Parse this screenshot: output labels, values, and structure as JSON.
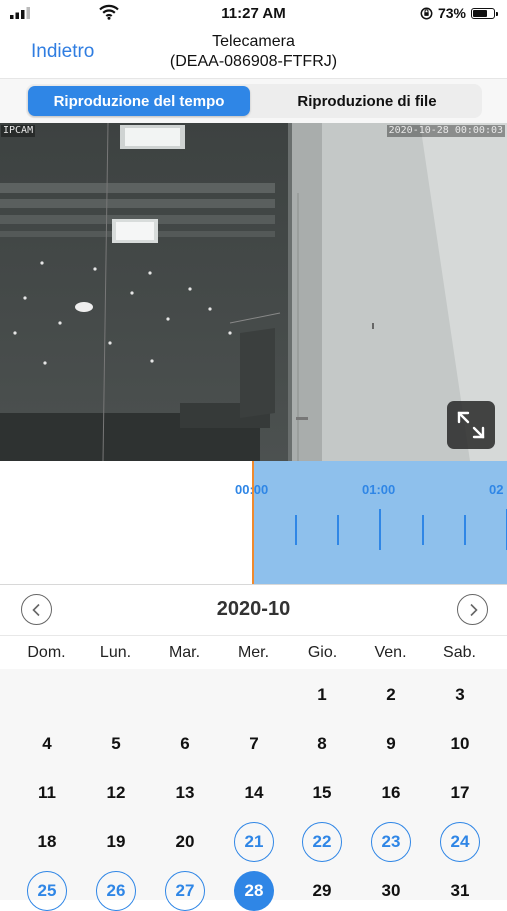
{
  "status_bar": {
    "time": "11:27 AM",
    "battery": "73%",
    "battery_level": 0.73,
    "icons": [
      "signal-icon",
      "wifi-icon",
      "rotation-lock-icon",
      "battery-icon"
    ]
  },
  "nav": {
    "back_label": "Indietro",
    "title_line1": "Telecamera",
    "title_line2": "(DEAA-086908-FTFRJ)"
  },
  "segment": {
    "tabs": [
      "Riproduzione del tempo",
      "Riproduzione di file"
    ],
    "active_index": 0
  },
  "video": {
    "camera_label": "IPCAM",
    "timestamp": "2020-10-28 00:00:03",
    "fullscreen_icon": "expand-icon"
  },
  "timeline": {
    "labels": [
      "00:00",
      "01:00",
      "02"
    ]
  },
  "calendar": {
    "month": "2020-10",
    "prev_icon": "chevron-left-icon",
    "next_icon": "chevron-right-icon",
    "weekdays": [
      "Dom.",
      "Lun.",
      "Mar.",
      "Mer.",
      "Gio.",
      "Ven.",
      "Sab."
    ],
    "first_weekday_index": 4,
    "visible_days": 31,
    "recorded_days": [
      21,
      22,
      23,
      24,
      25,
      26,
      27
    ],
    "selected_day": 28
  },
  "colors": {
    "accent": "#2f86e6",
    "timeline_range": "#8ec0ec",
    "playhead": "#f08a2e"
  }
}
